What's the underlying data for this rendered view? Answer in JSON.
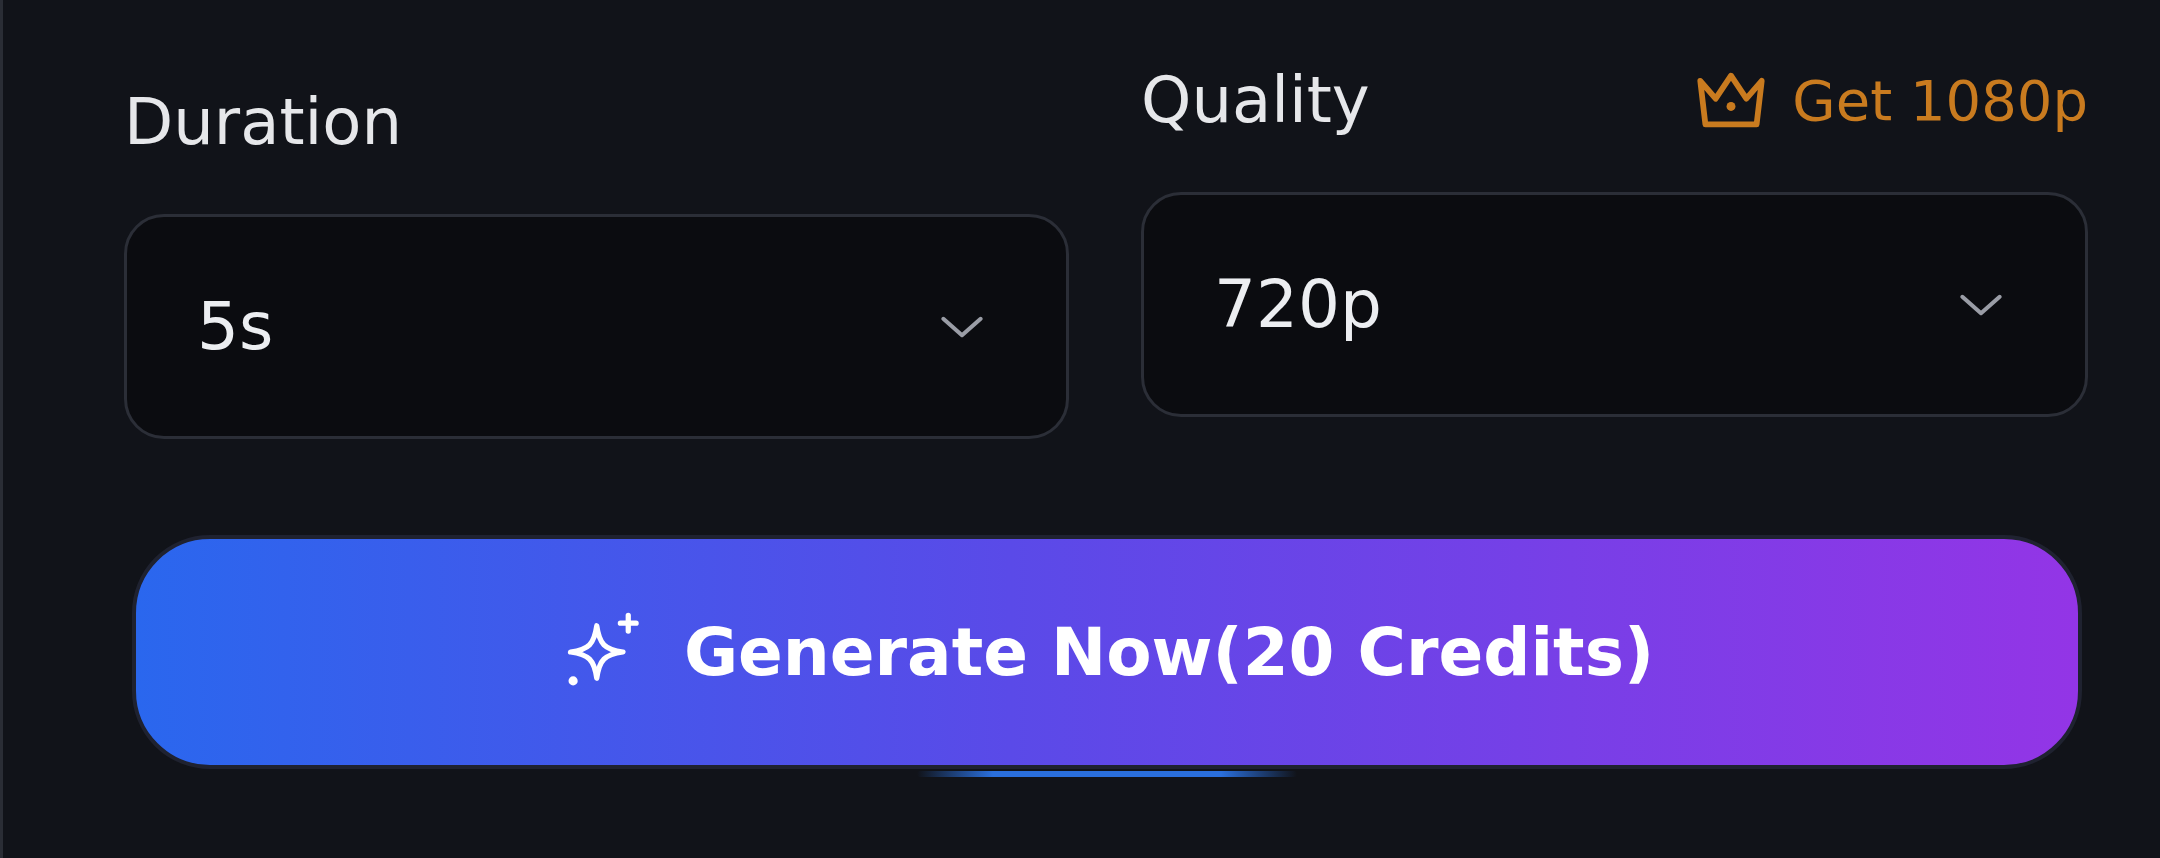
{
  "duration": {
    "label": "Duration",
    "value": "5s"
  },
  "quality": {
    "label": "Quality",
    "value": "720p",
    "upgrade": "Get 1080p"
  },
  "generate_button": {
    "label": "Generate Now(20 Credits)"
  }
}
